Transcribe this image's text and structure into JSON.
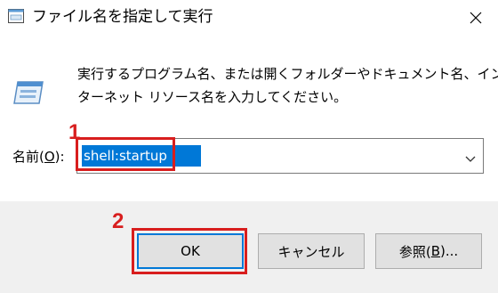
{
  "window": {
    "title": "ファイル名を指定して実行",
    "icon": "run-dialog-icon",
    "close_icon": "close-icon"
  },
  "content": {
    "description_lines": [
      "実行するプログラム名、または開くフォルダーやドキュメント名、イン",
      "ターネット リソース名を入力してください。"
    ],
    "icon": "run-program-icon"
  },
  "name_field": {
    "label_prefix": "名前(",
    "label_accesskey": "O",
    "label_suffix": "):",
    "value": "shell:startup",
    "selected": true
  },
  "buttons": {
    "ok": "OK",
    "cancel": "キャンセル",
    "browse_prefix": "参照(",
    "browse_accesskey": "B",
    "browse_suffix": ")..."
  },
  "annotations": {
    "step1": "1",
    "step2": "2",
    "highlight_color": "#d81e1e"
  },
  "colors": {
    "selection": "#0078d7",
    "footer_bg": "#f0f0f0",
    "button_bg": "#e1e1e1"
  }
}
